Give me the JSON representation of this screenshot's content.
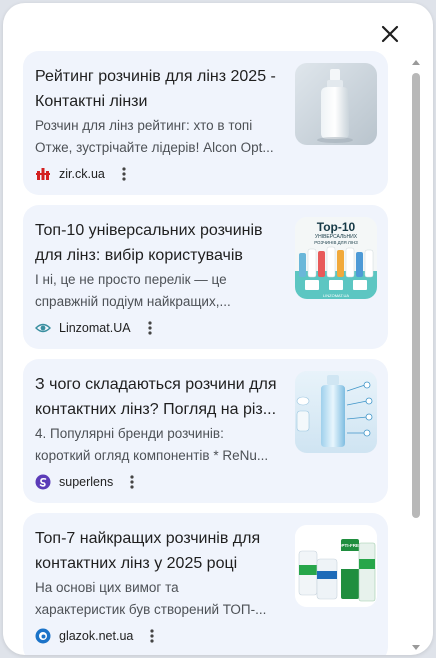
{
  "panel": {
    "close_icon": "close-icon"
  },
  "results": [
    {
      "title": "Рейтинг розчинів для лінз 2025 -\nКонтактні лінзи",
      "snippet": "Розчин для лінз рейтинг: хто в топі\nОтже, зустрічайте лідерів! Alcon Opt...",
      "source": "zir.ck.ua",
      "favicon": "zir-favicon",
      "thumb": "bottle-image"
    },
    {
      "title": "Топ-10 універсальних розчинів\nдля лінз: вибір користувачів",
      "snippet": "І ні, це не просто перелік — це\nсправжній подіум найкращих,...",
      "source": "Linzomat.UA",
      "favicon": "eye-favicon",
      "thumb": "top10-image",
      "thumb_text": {
        "heading": "Top-10",
        "line1": "УНІВЕРСАЛЬНИХ",
        "line2": "РОЗЧИНІВ ДЛЯ ЛІНЗ",
        "footer": "LINZOMAT.UA"
      }
    },
    {
      "title": "З чого складаються розчини для\nконтактних лінз? Погляд на різ...",
      "snippet": "4. Популярні бренди розчинів:\nкороткий огляд компонентів * ReNu...",
      "source": "superlens",
      "favicon": "superlens-favicon",
      "thumb": "solution-diagram-image"
    },
    {
      "title": "Топ-7 найкращих розчинів для\nконтактних лінз у 2025 році",
      "snippet": "На основі цих вимог та\nхарактеристик був створений ТОП-...",
      "source": "glazok.net.ua",
      "favicon": "glazok-favicon",
      "thumb": "products-image",
      "thumb_text": {
        "brand": "OPTI-FREE"
      }
    }
  ],
  "colors": {
    "card_bg": "#f0f4fc",
    "title": "#1f1f1f",
    "snippet": "#4d5156",
    "scroll_thumb": "#b8b8b8"
  }
}
